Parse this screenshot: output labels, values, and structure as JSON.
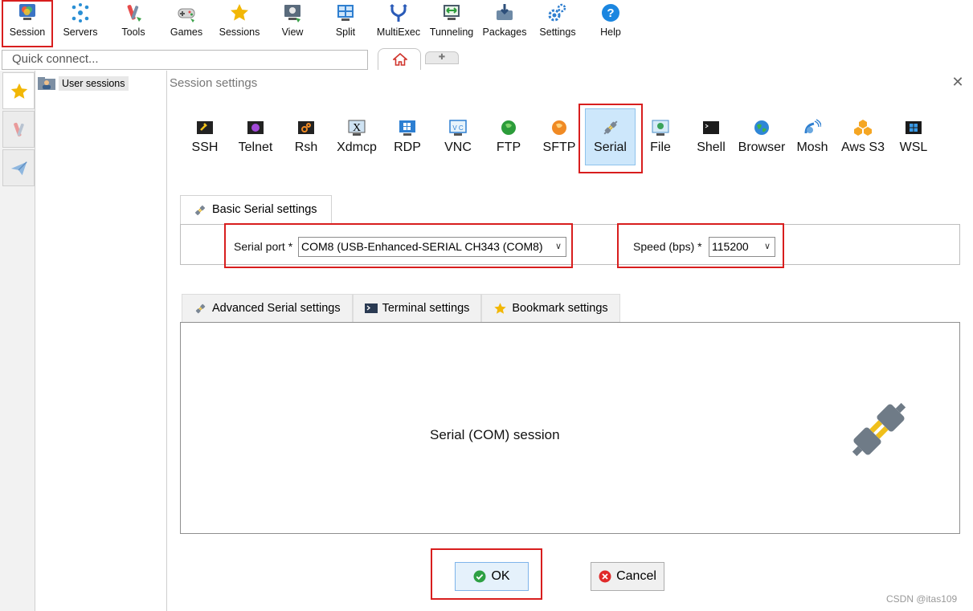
{
  "toolbar": {
    "items": [
      {
        "label": "Session",
        "icon": "session-icon"
      },
      {
        "label": "Servers",
        "icon": "servers-icon"
      },
      {
        "label": "Tools",
        "icon": "tools-icon"
      },
      {
        "label": "Games",
        "icon": "games-icon"
      },
      {
        "label": "Sessions",
        "icon": "star-icon"
      },
      {
        "label": "View",
        "icon": "view-icon"
      },
      {
        "label": "Split",
        "icon": "split-icon"
      },
      {
        "label": "MultiExec",
        "icon": "multiexec-icon"
      },
      {
        "label": "Tunneling",
        "icon": "tunneling-icon"
      },
      {
        "label": "Packages",
        "icon": "packages-icon"
      },
      {
        "label": "Settings",
        "icon": "settings-icon"
      },
      {
        "label": "Help",
        "icon": "help-icon"
      }
    ]
  },
  "quick_connect": {
    "placeholder": "Quick connect..."
  },
  "sidebar": {
    "user_sessions": "User sessions"
  },
  "dialog": {
    "title": "Session settings",
    "session_types": [
      {
        "label": "SSH",
        "icon": "ssh-icon"
      },
      {
        "label": "Telnet",
        "icon": "telnet-icon"
      },
      {
        "label": "Rsh",
        "icon": "rsh-icon"
      },
      {
        "label": "Xdmcp",
        "icon": "xdmcp-icon"
      },
      {
        "label": "RDP",
        "icon": "rdp-icon"
      },
      {
        "label": "VNC",
        "icon": "vnc-icon"
      },
      {
        "label": "FTP",
        "icon": "ftp-icon"
      },
      {
        "label": "SFTP",
        "icon": "sftp-icon"
      },
      {
        "label": "Serial",
        "icon": "serial-plug-icon",
        "selected": true
      },
      {
        "label": "File",
        "icon": "file-icon"
      },
      {
        "label": "Shell",
        "icon": "shell-icon"
      },
      {
        "label": "Browser",
        "icon": "browser-icon"
      },
      {
        "label": "Mosh",
        "icon": "mosh-icon"
      },
      {
        "label": "Aws S3",
        "icon": "aws-s3-icon"
      },
      {
        "label": "WSL",
        "icon": "wsl-icon"
      }
    ],
    "basic_tab_label": "Basic Serial settings",
    "serial_port_label": "Serial port *",
    "serial_port_value": "COM8  (USB-Enhanced-SERIAL CH343 (COM8)",
    "speed_label": "Speed (bps) *",
    "speed_value": "115200",
    "advanced_tabs": [
      {
        "label": "Advanced Serial settings",
        "icon": "plug-icon"
      },
      {
        "label": "Terminal settings",
        "icon": "terminal-icon"
      },
      {
        "label": "Bookmark settings",
        "icon": "star-icon"
      }
    ],
    "session_description": "Serial (COM) session",
    "ok_label": "OK",
    "cancel_label": "Cancel"
  },
  "watermark": "CSDN @itas109",
  "colors": {
    "highlight_red": "#d81e1e",
    "selected_blue": "#cde7fb"
  }
}
